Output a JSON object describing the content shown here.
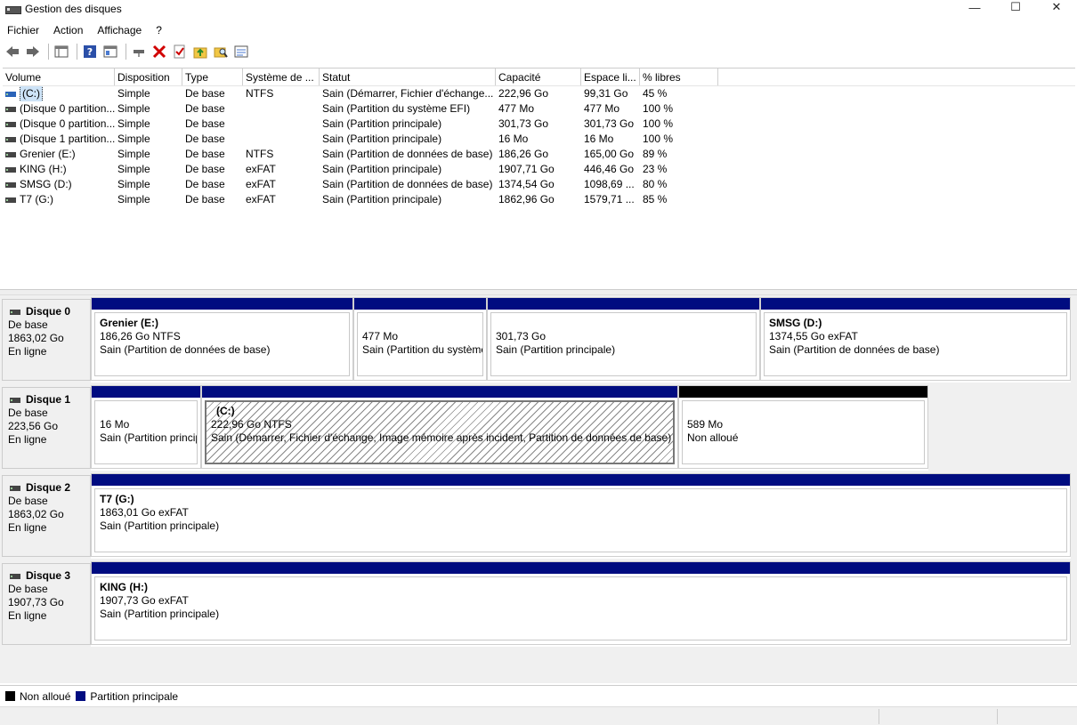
{
  "window": {
    "title": "Gestion des disques",
    "minimize_glyph": "—",
    "maximize_glyph": "☐",
    "close_glyph": "✕"
  },
  "menu": [
    "Fichier",
    "Action",
    "Affichage",
    "?"
  ],
  "toolbar_icons": [
    "back-arrow-icon",
    "forward-arrow-icon",
    "console-tree-icon",
    "help-icon",
    "properties-icon",
    "connect-drive-icon",
    "delete-icon",
    "check-icon",
    "folder-up-icon",
    "search-folder-icon",
    "disk-list-icon"
  ],
  "volume_list": {
    "columns": [
      "Volume",
      "Disposition",
      "Type",
      "Système de ...",
      "Statut",
      "Capacité",
      "Espace li...",
      "% libres"
    ],
    "rows": [
      {
        "volume": "(C:)",
        "disposition": "Simple",
        "type": "De base",
        "fs": "NTFS",
        "statut": "Sain (Démarrer, Fichier d'échange...",
        "capacite": "222,96 Go",
        "espace": "99,31 Go",
        "pct": "45 %"
      },
      {
        "volume": "(Disque 0 partition...",
        "disposition": "Simple",
        "type": "De base",
        "fs": "",
        "statut": "Sain (Partition du système EFI)",
        "capacite": "477 Mo",
        "espace": "477 Mo",
        "pct": "100 %"
      },
      {
        "volume": "(Disque 0 partition...",
        "disposition": "Simple",
        "type": "De base",
        "fs": "",
        "statut": "Sain (Partition principale)",
        "capacite": "301,73 Go",
        "espace": "301,73 Go",
        "pct": "100 %"
      },
      {
        "volume": "(Disque 1 partition...",
        "disposition": "Simple",
        "type": "De base",
        "fs": "",
        "statut": "Sain (Partition principale)",
        "capacite": "16 Mo",
        "espace": "16 Mo",
        "pct": "100 %"
      },
      {
        "volume": "Grenier (E:)",
        "disposition": "Simple",
        "type": "De base",
        "fs": "NTFS",
        "statut": "Sain (Partition de données de base)",
        "capacite": "186,26 Go",
        "espace": "165,00 Go",
        "pct": "89 %"
      },
      {
        "volume": "KING (H:)",
        "disposition": "Simple",
        "type": "De base",
        "fs": "exFAT",
        "statut": "Sain (Partition principale)",
        "capacite": "1907,71 Go",
        "espace": "446,46 Go",
        "pct": "23 %"
      },
      {
        "volume": "SMSG (D:)",
        "disposition": "Simple",
        "type": "De base",
        "fs": "exFAT",
        "statut": "Sain (Partition de données de base)",
        "capacite": "1374,54 Go",
        "espace": "1098,69 ...",
        "pct": "80 %"
      },
      {
        "volume": "T7 (G:)",
        "disposition": "Simple",
        "type": "De base",
        "fs": "exFAT",
        "statut": "Sain (Partition principale)",
        "capacite": "1862,96 Go",
        "espace": "1579,71 ...",
        "pct": "85 %"
      }
    ]
  },
  "disks": [
    {
      "name": "Disque 0",
      "type": "De base",
      "size": "1863,02 Go",
      "state": "En ligne",
      "partitions": [
        {
          "name": "Grenier  (E:)",
          "size": "186,26 Go NTFS",
          "status": "Sain (Partition de données de base)"
        },
        {
          "name": "",
          "size": "477 Mo",
          "status": "Sain (Partition du système EFI)"
        },
        {
          "name": "",
          "size": "301,73 Go",
          "status": "Sain (Partition principale)"
        },
        {
          "name": "SMSG  (D:)",
          "size": "1374,55 Go exFAT",
          "status": "Sain (Partition de données de base)"
        }
      ]
    },
    {
      "name": "Disque 1",
      "type": "De base",
      "size": "223,56 Go",
      "state": "En ligne",
      "partitions": [
        {
          "name": "",
          "size": "16 Mo",
          "status": "Sain (Partition principale)"
        },
        {
          "name": "(C:)",
          "size": "222,96 Go NTFS",
          "status": "Sain (Démarrer, Fichier d'échange, Image mémoire après incident, Partition de données de base)"
        },
        {
          "name": "",
          "size": "589 Mo",
          "status": "Non alloué"
        }
      ]
    },
    {
      "name": "Disque 2",
      "type": "De base",
      "size": "1863,02 Go",
      "state": "En ligne",
      "partitions": [
        {
          "name": "T7  (G:)",
          "size": "1863,01 Go exFAT",
          "status": "Sain (Partition principale)"
        }
      ]
    },
    {
      "name": "Disque 3",
      "type": "De base",
      "size": "1907,73 Go",
      "state": "En ligne",
      "partitions": [
        {
          "name": "KING  (H:)",
          "size": "1907,73 Go exFAT",
          "status": "Sain (Partition principale)"
        }
      ]
    }
  ],
  "legend": {
    "unallocated": {
      "label": "Non alloué",
      "color": "#000000"
    },
    "primary": {
      "label": "Partition principale",
      "color": "#000c80"
    }
  }
}
